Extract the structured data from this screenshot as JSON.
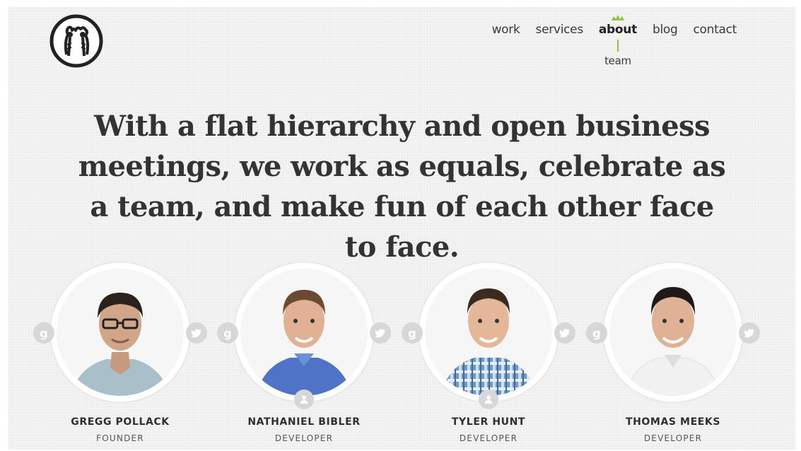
{
  "nav": {
    "items": [
      {
        "label": "work"
      },
      {
        "label": "services"
      },
      {
        "label": "about",
        "active": true
      },
      {
        "label": "blog"
      },
      {
        "label": "contact"
      }
    ],
    "subnav_label": "team",
    "accent_color": "#8cc63f"
  },
  "headline": "With a flat hierarchy and open business meetings, we work as equals, celebrate as a team, and make fun of each other face to face.",
  "team": [
    {
      "name": "GREGG POLLACK",
      "role": "FOUNDER",
      "icons": [
        "google-plus-icon",
        "twitter-icon"
      ]
    },
    {
      "name": "NATHANIEL BIBLER",
      "role": "DEVELOPER",
      "icons": [
        "google-plus-icon",
        "twitter-icon",
        "person-icon"
      ]
    },
    {
      "name": "TYLER HUNT",
      "role": "DEVELOPER",
      "icons": [
        "google-plus-icon",
        "twitter-icon",
        "person-icon"
      ]
    },
    {
      "name": "THOMAS MEEKS",
      "role": "DEVELOPER",
      "icons": [
        "google-plus-icon",
        "twitter-icon"
      ]
    }
  ],
  "social_glyphs": {
    "google": "g"
  }
}
